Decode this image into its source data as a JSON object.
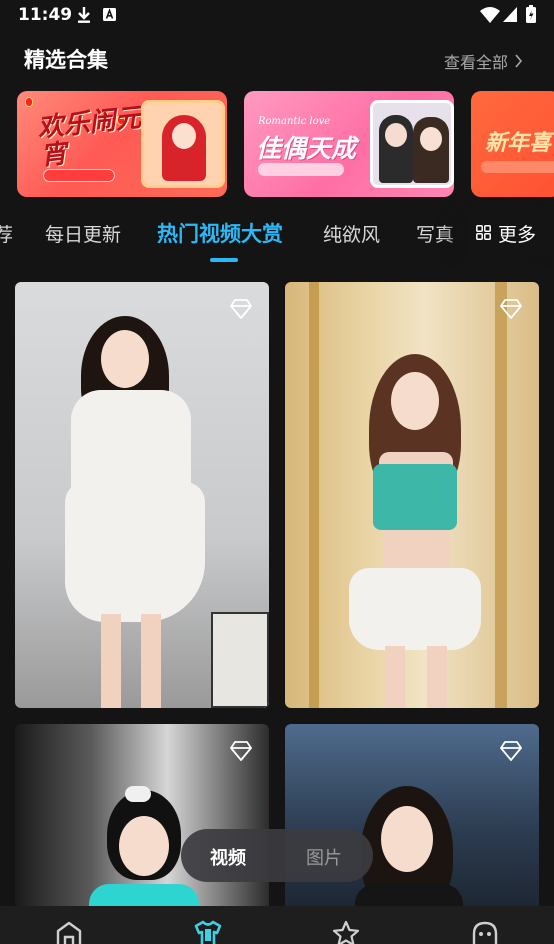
{
  "status_bar": {
    "time": "11:49"
  },
  "collection": {
    "title": "精选合集",
    "see_all": "查看全部",
    "banners": [
      {
        "title": "欢乐闹元宵"
      },
      {
        "subtitle": "Romantic love",
        "title": "佳偶天成"
      },
      {
        "title": "新年喜"
      }
    ]
  },
  "tabs": {
    "items": [
      "荐",
      "每日更新",
      "热门视频大赏",
      "纯欲风",
      "写真"
    ],
    "active_index": 2,
    "more": "更多"
  },
  "media_toggle": {
    "video": "视频",
    "image": "图片",
    "selected": "视频"
  },
  "bottom_nav": {
    "items": [
      {
        "icon": "home-icon"
      },
      {
        "icon": "outfit-icon",
        "active": true
      },
      {
        "icon": "star-icon"
      },
      {
        "icon": "profile-icon"
      }
    ]
  },
  "colors": {
    "background": "#141414",
    "accent": "#2bb8f5",
    "active_nav": "#3fd0e6"
  }
}
